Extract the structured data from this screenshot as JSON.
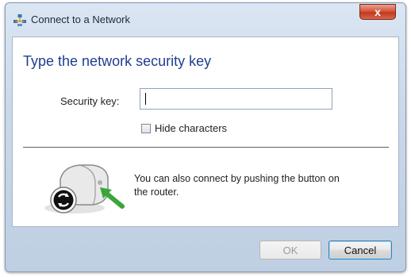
{
  "window": {
    "title": "Connect to a Network",
    "close_label": "x"
  },
  "main": {
    "heading": "Type the network security key",
    "security_key_label": "Security key:",
    "security_key_value": "",
    "hide_characters_label": "Hide characters",
    "hide_characters_checked": false,
    "wps_message": "You can also connect by pushing the button on the router."
  },
  "footer": {
    "ok_label": "OK",
    "cancel_label": "Cancel"
  },
  "icons": {
    "title_icon": "network-icon",
    "router_icon": "router-wps-icon"
  }
}
